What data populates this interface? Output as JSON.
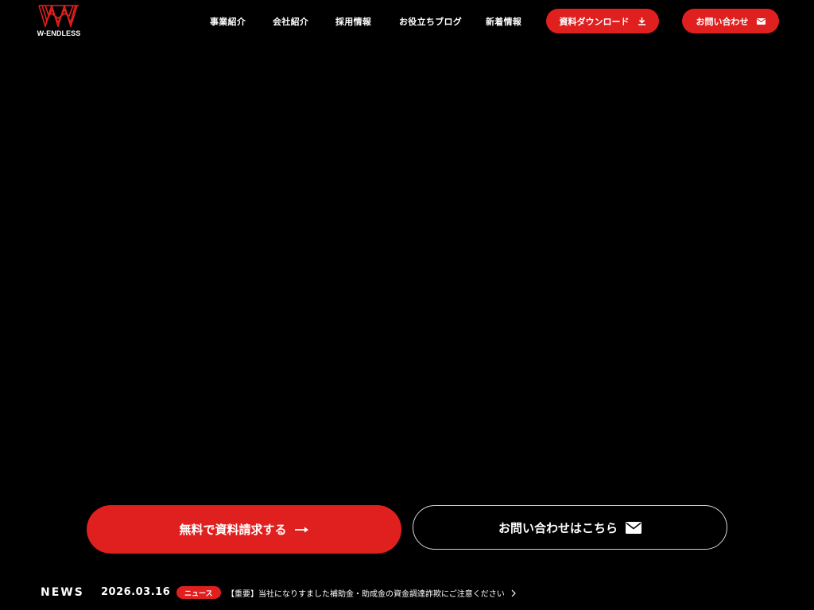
{
  "logo": {
    "text": "W-ENDLESS",
    "color": "#e0201f"
  },
  "nav": {
    "items": [
      {
        "label": "事業紹介"
      },
      {
        "label": "会社紹介"
      },
      {
        "label": "採用情報"
      },
      {
        "label": "お役立ちブログ"
      },
      {
        "label": "新着情報"
      }
    ],
    "download_button": {
      "label": "資料ダウンロード",
      "icon": "download-icon"
    },
    "contact_button": {
      "label": "お問い合わせ",
      "icon": "mail-icon"
    }
  },
  "cta": {
    "download": {
      "label": "無料で資料請求する",
      "icon": "arrow-right-icon"
    },
    "contact": {
      "label": "お問い合わせはこちら",
      "icon": "mail-icon"
    }
  },
  "news": {
    "heading": "NEWS",
    "date": "2026.03.16",
    "category": "ニュース",
    "title": "【重要】当社になりすました補助金・助成金の資金調達詐欺にご注意ください",
    "icon": "chevron-right-icon"
  },
  "colors": {
    "accent": "#e0201f",
    "background": "#000000",
    "text": "#ffffff"
  }
}
